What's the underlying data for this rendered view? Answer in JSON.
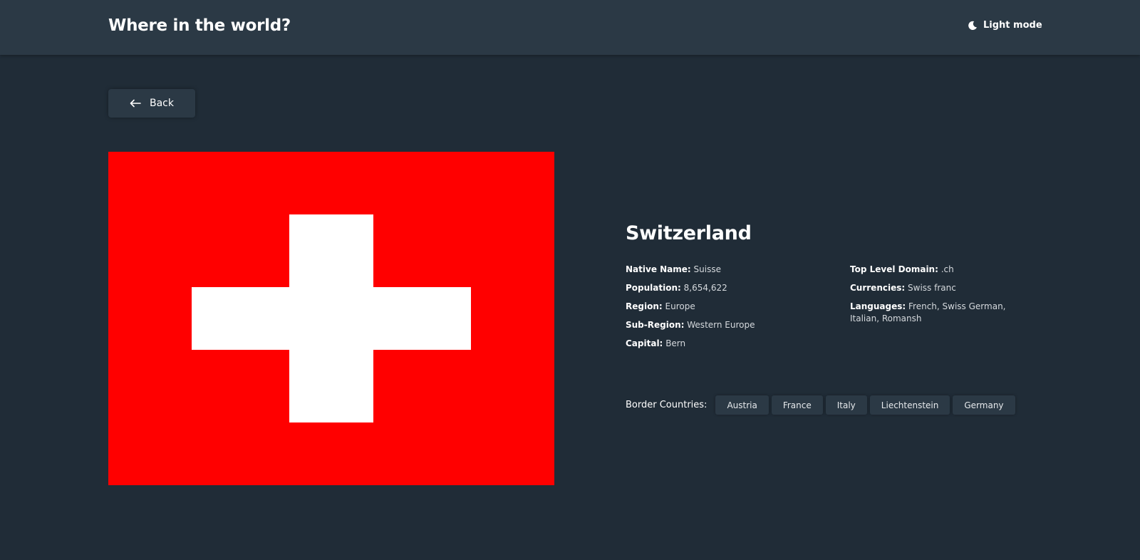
{
  "header": {
    "title": "Where in the world?",
    "theme_toggle_label": "Light mode",
    "theme_icon": "moon-icon"
  },
  "back_button": {
    "label": "Back",
    "icon": "arrow-left-icon"
  },
  "country": {
    "name": "Switzerland",
    "flag": {
      "icon": "swiss-flag",
      "colors": {
        "field": "#ff0000",
        "cross": "#ffffff"
      }
    },
    "details_left": [
      {
        "label": "Native Name:",
        "value": "Suisse"
      },
      {
        "label": "Population:",
        "value": "8,654,622"
      },
      {
        "label": "Region:",
        "value": "Europe"
      },
      {
        "label": "Sub-Region:",
        "value": "Western Europe"
      },
      {
        "label": "Capital:",
        "value": "Bern"
      }
    ],
    "details_right": [
      {
        "label": "Top Level Domain:",
        "value": ".ch"
      },
      {
        "label": "Currencies:",
        "value": "Swiss franc"
      },
      {
        "label": "Languages:",
        "value": "French, Swiss German, Italian, Romansh"
      }
    ],
    "border_label": "Border Countries:",
    "border_countries": [
      "Austria",
      "France",
      "Italy",
      "Liechtenstein",
      "Germany"
    ]
  },
  "colors": {
    "background": "#202c37",
    "surface": "#2b3945",
    "text": "#ffffff"
  }
}
